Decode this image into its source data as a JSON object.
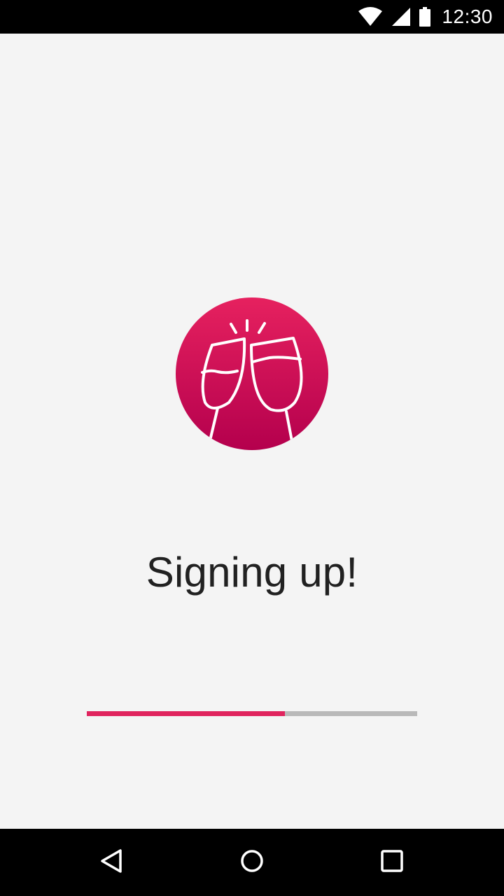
{
  "status_bar": {
    "time": "12:30",
    "icons": [
      "wifi-icon",
      "cell-signal-icon",
      "battery-icon"
    ]
  },
  "main": {
    "logo_icon": "champagne-toast-icon",
    "title": "Signing up!",
    "progress_fraction": 0.6
  },
  "nav_bar": {
    "icons": [
      "back-icon",
      "home-icon",
      "recents-icon"
    ]
  },
  "colors": {
    "accent": "#e0245e",
    "logo_gradient_top": "#e6215f",
    "logo_gradient_bottom": "#b4004d",
    "track": "#b9b9b9",
    "background": "#f4f4f4",
    "text": "#212121"
  }
}
